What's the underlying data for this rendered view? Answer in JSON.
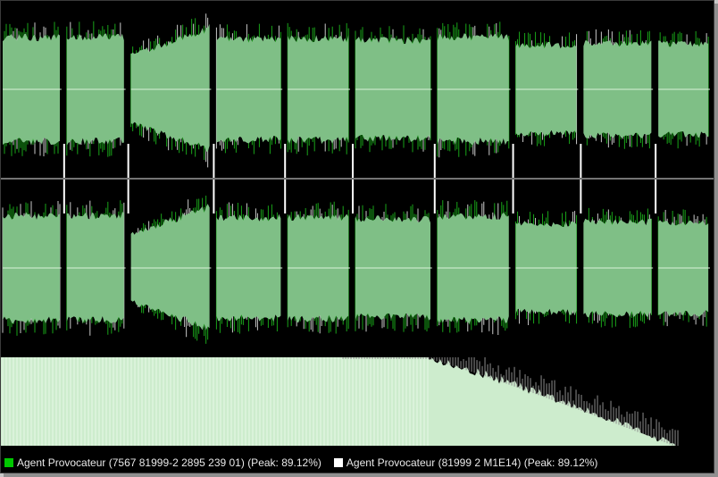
{
  "colors": {
    "background": "#000000",
    "waveform_fill": "#7fbf86",
    "waveform_peak_green": "#19a319",
    "waveform_peak_white": "#c9c9c9",
    "spectrum_fill": "#cdeccd",
    "divider": "#9a9a9a",
    "track_gap_marker": "#ffffff"
  },
  "chart_data": {
    "type": "area",
    "channels": [
      "upper",
      "lower"
    ],
    "track_boundaries_fraction": [
      0.09,
      0.18,
      0.3,
      0.4,
      0.495,
      0.61,
      0.72,
      0.815,
      0.92
    ],
    "tracks": [
      {
        "index": 1,
        "shape": "flat",
        "level": 0.85
      },
      {
        "index": 2,
        "shape": "flat",
        "level": 0.85
      },
      {
        "index": 3,
        "shape": "crescendo",
        "level": 1.0
      },
      {
        "index": 4,
        "shape": "flat",
        "level": 0.82
      },
      {
        "index": 5,
        "shape": "flat",
        "level": 0.83
      },
      {
        "index": 6,
        "shape": "flat",
        "level": 0.8
      },
      {
        "index": 7,
        "shape": "flat",
        "level": 0.85
      },
      {
        "index": 8,
        "shape": "flat",
        "level": 0.72
      },
      {
        "index": 9,
        "shape": "flat",
        "level": 0.75
      },
      {
        "index": 10,
        "shape": "flat",
        "level": 0.74
      }
    ],
    "spectrum": {
      "description_shape": "descending",
      "flat_until_fraction": 0.6,
      "end_fraction": 0.95
    },
    "series": [
      {
        "name": "Agent Provocateur (7567 81999-2 2895 239 01) (Peak: 89.12%)",
        "color": "#00c800"
      },
      {
        "name": "Agent Provocateur (81999 2 M1E14) (Peak: 89.12%)",
        "color": "#ffffff"
      }
    ]
  },
  "legend": {
    "item1": {
      "label": "Agent Provocateur (7567 81999-2 2895 239 01) (Peak: 89.12%)",
      "color": "#00c800",
      "icon": "green-square-icon"
    },
    "item2": {
      "label": "Agent Provocateur (81999 2 M1E14) (Peak: 89.12%)",
      "color": "#ffffff",
      "icon": "white-square-icon"
    }
  }
}
